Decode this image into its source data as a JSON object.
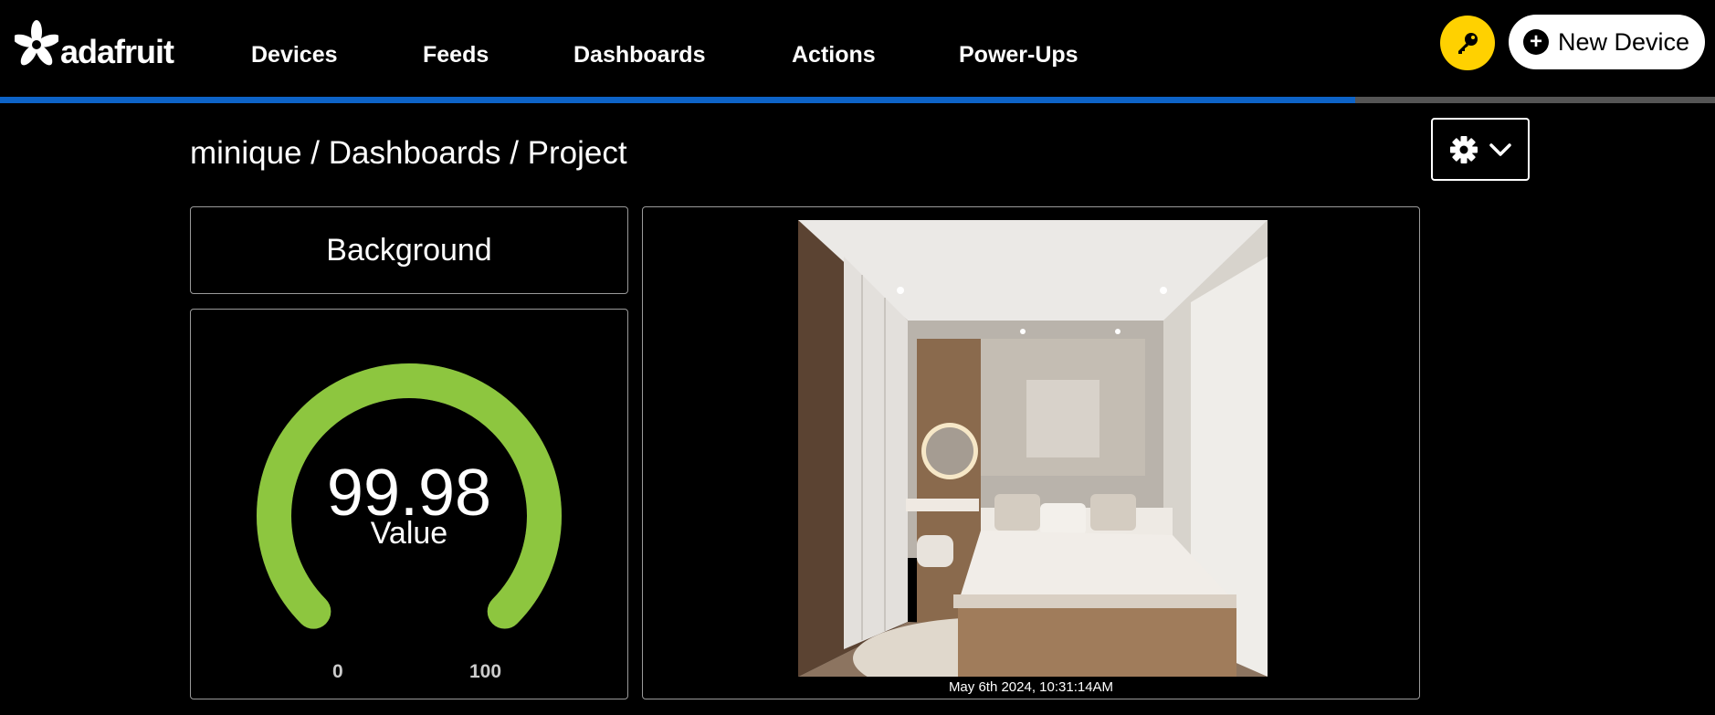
{
  "brand": {
    "logo_text": "adafruit"
  },
  "nav": {
    "items": [
      {
        "label": "Devices"
      },
      {
        "label": "Feeds"
      },
      {
        "label": "Dashboards"
      },
      {
        "label": "Actions"
      },
      {
        "label": "Power-Ups"
      }
    ]
  },
  "header": {
    "key_icon": "key-icon",
    "new_device_label": "New Device",
    "progress": 0.79,
    "accent_color": "#0d63c7",
    "key_button_color": "#ffd100"
  },
  "breadcrumb": {
    "text": "minique / Dashboards / Project"
  },
  "settings": {
    "icon": "gear-icon",
    "dropdown_icon": "chevron-down-icon"
  },
  "blocks": {
    "text_block": {
      "label": "Background"
    },
    "gauge": {
      "value": "99.98",
      "label": "Value",
      "min": "0",
      "max": "100",
      "level": 0.9998,
      "color": "#8dc63f"
    },
    "image": {
      "timestamp": "May 6th 2024, 10:31:14AM"
    }
  }
}
